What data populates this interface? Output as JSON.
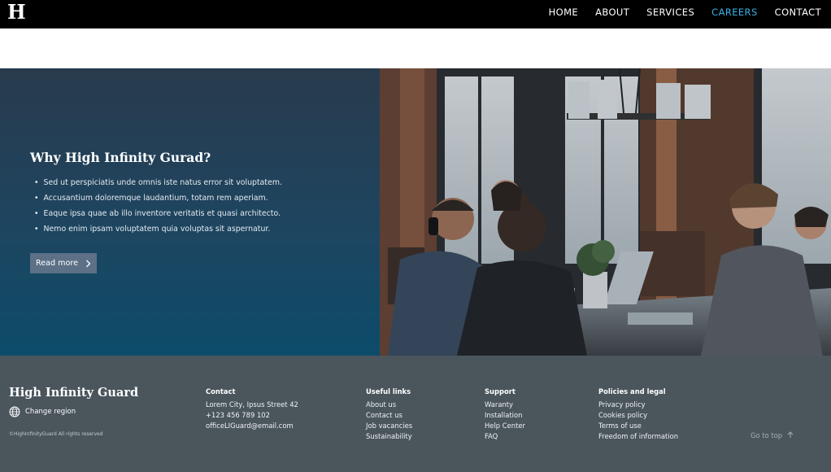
{
  "nav": {
    "logo": "H",
    "links": [
      "HOME",
      "ABOUT",
      "SERVICES",
      "CAREERS",
      "CONTACT"
    ],
    "active": "CAREERS",
    "active_color": "#3bb0e6"
  },
  "hero": {
    "title": "Why High Infinity Gurad?",
    "bullets": [
      "Sed ut perspiciatis unde omnis iste natus error sit voluptatem.",
      "Accusantium doloremque laudantium, totam rem aperiam.",
      "Eaque ipsa quae ab illo inventore veritatis et quasi architecto.",
      "Nemo enim ipsam voluptatem quia voluptas sit aspernatur."
    ],
    "read_more": "Read more",
    "read_more_icon": "chevron-right-icon"
  },
  "footer": {
    "brand": "High Infinity Guard",
    "change_region": "Change region",
    "region_icon": "globe-icon",
    "copyright": "©HighInfinityGuard All rights reserved",
    "contact": {
      "title": "Contact",
      "lines": [
        "Lorem City, Ipsus Street 42",
        "+123 456 789 102",
        "officeLIGuard@email.com"
      ]
    },
    "useful_links": {
      "title": "Useful links",
      "lines": [
        "About us",
        "Contact us",
        "Job vacancies",
        "Sustainability"
      ]
    },
    "support": {
      "title": "Support",
      "lines": [
        "Waranty",
        "Installation",
        "Help Center",
        "FAQ"
      ]
    },
    "policies": {
      "title": "Policies and legal",
      "lines": [
        "Privacy policy",
        "Cookies policy",
        "Terms of use",
        "Freedom of information"
      ]
    },
    "go_to_top": "Go to top",
    "go_to_top_icon": "arrow-up-icon"
  }
}
